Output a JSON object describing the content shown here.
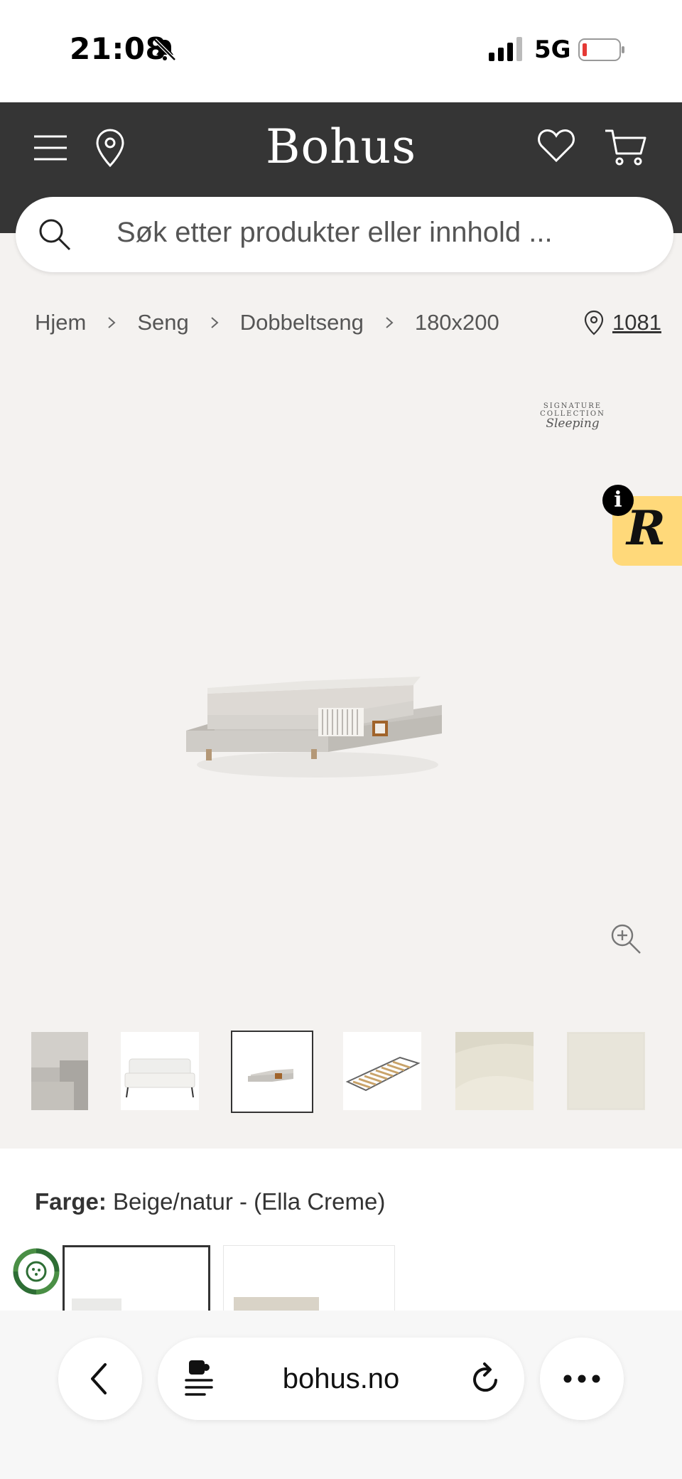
{
  "status_bar": {
    "time": "21:08",
    "network": "5G",
    "battery_color": "#e53935"
  },
  "header": {
    "logo": "Bohus",
    "background": "#353535"
  },
  "search": {
    "placeholder": "Søk etter produkter eller innhold ..."
  },
  "breadcrumb": {
    "items": [
      "Hjem",
      "Seng",
      "Dobbeltseng",
      "180x200"
    ]
  },
  "store_location": {
    "code": "1081"
  },
  "gallery": {
    "brand_tag_top": "SIGNATURE COLLECTION",
    "brand_tag_script": "Sleeping",
    "badge_letter": "R",
    "badge_color": "#ffd97a",
    "info_label": "i",
    "thumbnails": [
      "fabric-closeup",
      "white-bed",
      "bed-cross-section",
      "slatted-frame",
      "fabric-swatch",
      "fabric-swatch-plain"
    ],
    "selected_thumbnail": 2
  },
  "product": {
    "color_label": "Farge:",
    "color_value": "Beige/natur - (Ella Creme)"
  },
  "browser": {
    "domain": "bohus.no"
  }
}
